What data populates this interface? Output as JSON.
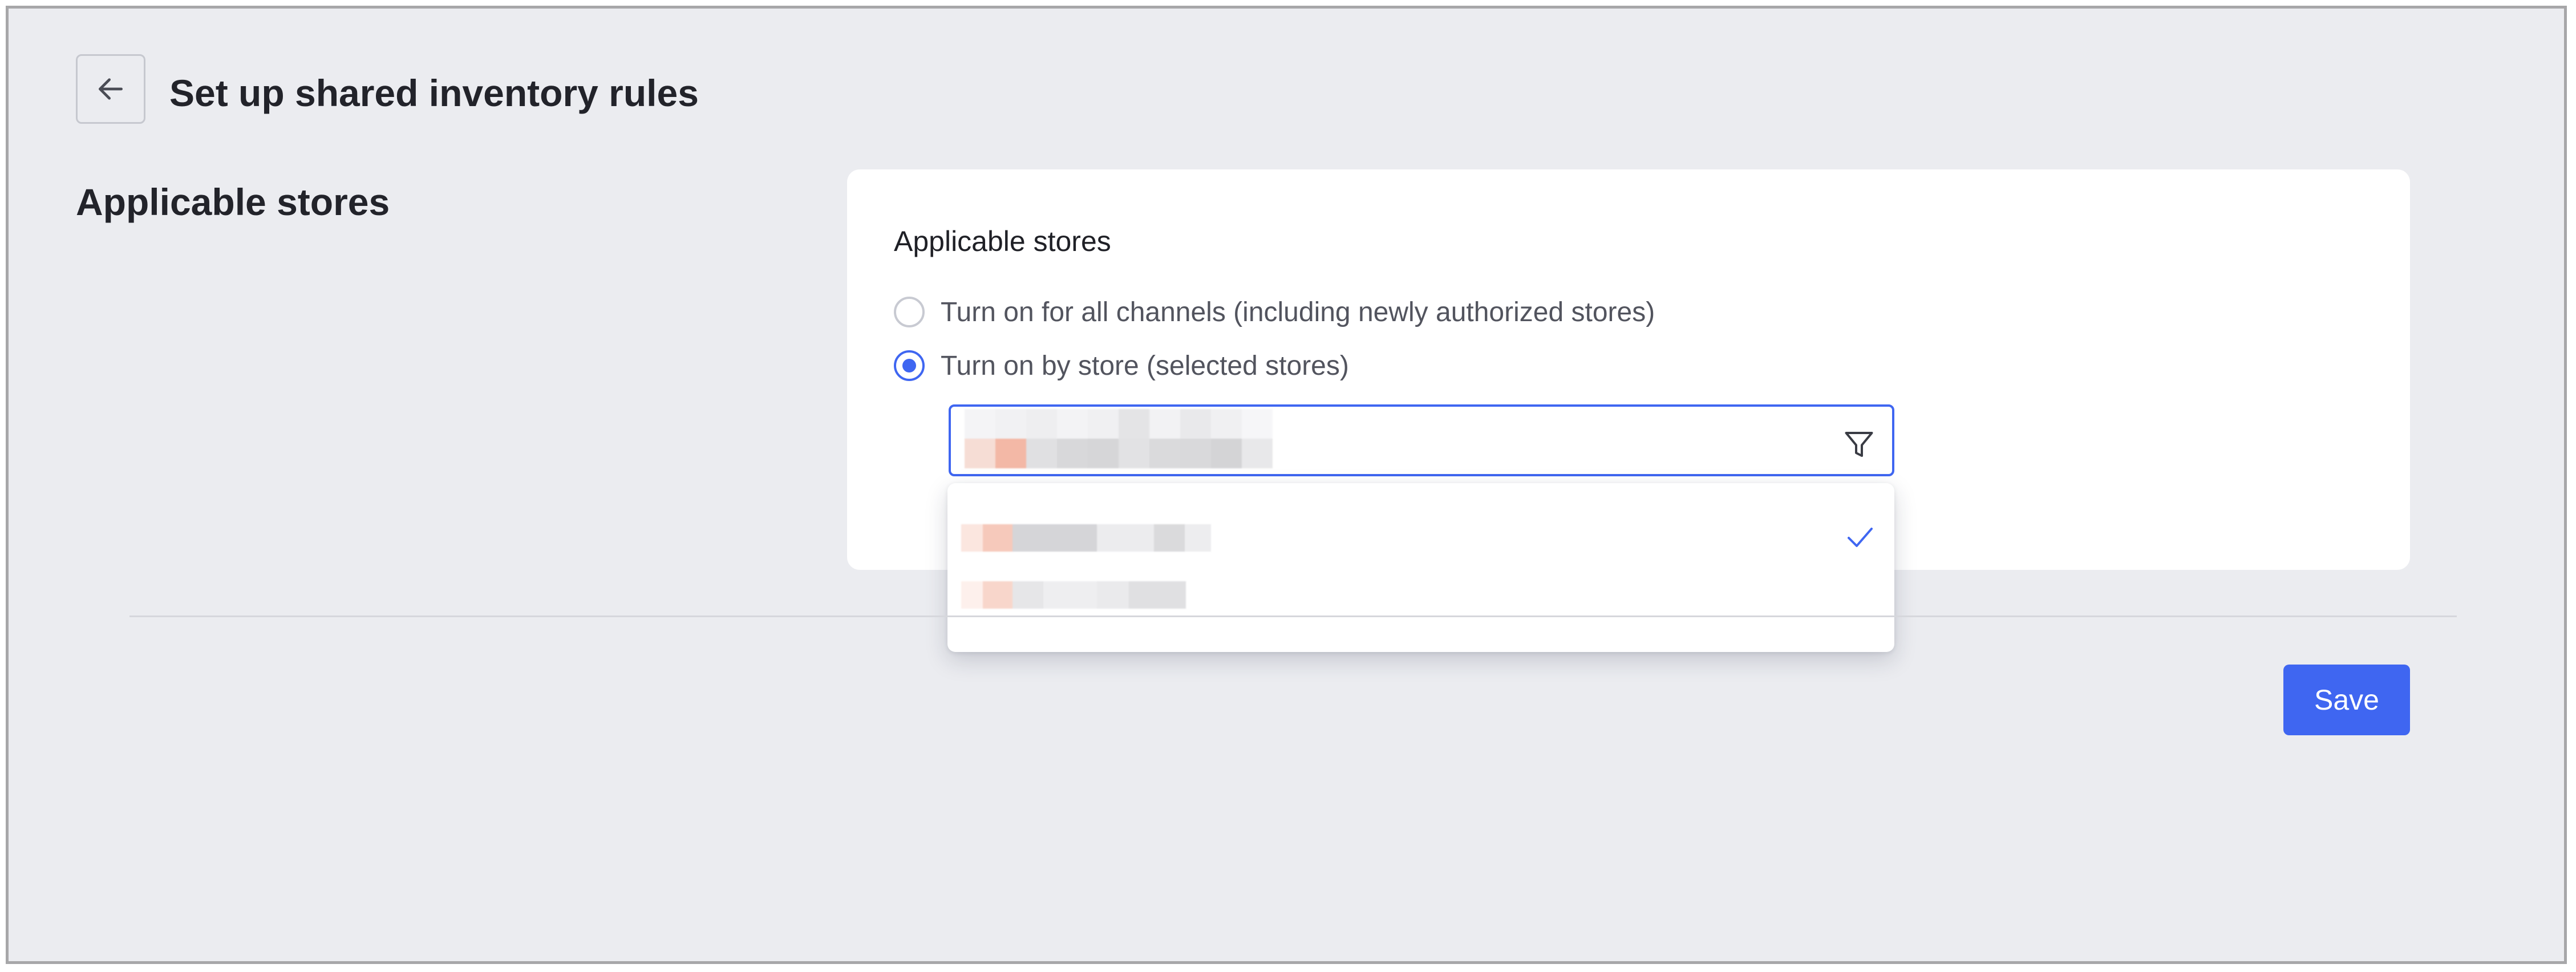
{
  "header": {
    "back_icon": "arrow-left-icon",
    "title": "Set up shared inventory rules"
  },
  "section": {
    "title": "Applicable stores"
  },
  "card": {
    "title": "Applicable stores",
    "options": [
      {
        "label": "Turn on for all channels (including newly authorized stores)",
        "selected": false
      },
      {
        "label": "Turn on by store (selected stores)",
        "selected": true
      }
    ]
  },
  "store_select": {
    "filter_icon": "filter-icon",
    "dropdown": {
      "items": [
        {
          "label": "",
          "checked": true
        },
        {
          "label": "",
          "checked": false
        }
      ],
      "check_icon": "check-icon"
    }
  },
  "footer": {
    "save_label": "Save"
  },
  "colors": {
    "accent": "#3f66f1",
    "background": "#ebecf0",
    "card": "#ffffff",
    "text_primary": "#22232a",
    "text_secondary": "#52545e"
  }
}
